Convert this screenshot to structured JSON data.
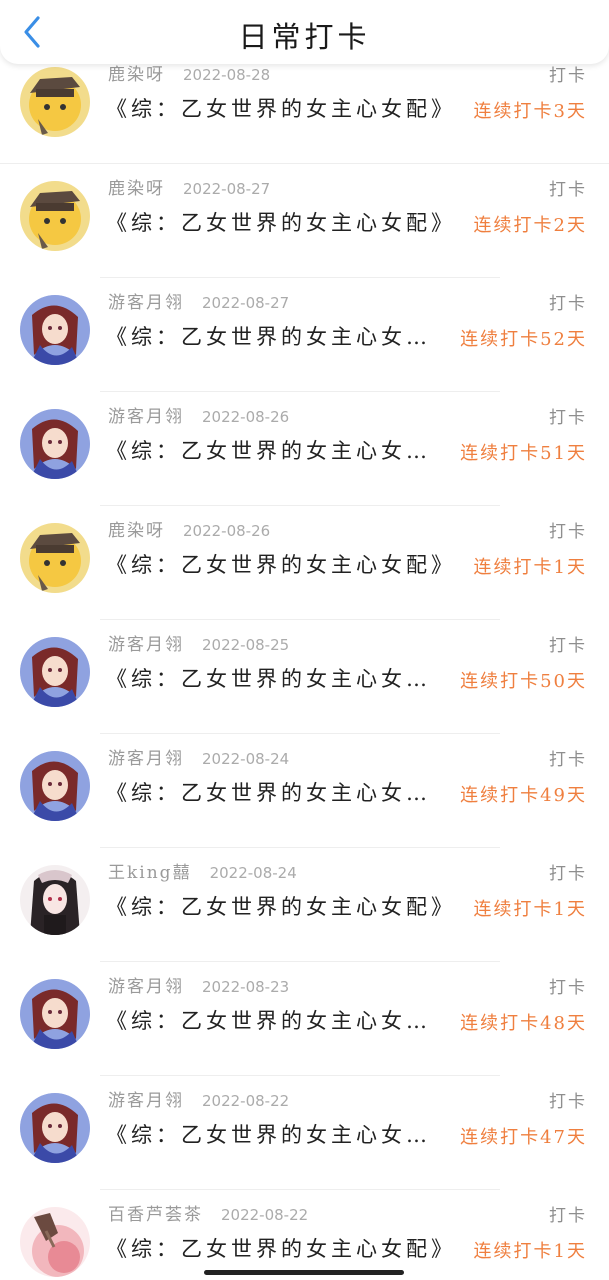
{
  "header": {
    "title": "日常打卡",
    "accent_color": "#3a8ee6"
  },
  "checkins": [
    {
      "user": "鹿染呀",
      "date": "2022-08-28",
      "tag": "打卡",
      "book": "《综：乙女世界的女主心女配》",
      "streak": "连续打卡3天",
      "avatar": "yellow-hat-character-icon"
    },
    {
      "user": "鹿染呀",
      "date": "2022-08-27",
      "tag": "打卡",
      "book": "《综：乙女世界的女主心女配》",
      "streak": "连续打卡2天",
      "avatar": "yellow-hat-character-icon"
    },
    {
      "user": "游客月翎",
      "date": "2022-08-27",
      "tag": "打卡",
      "book": "《综：乙女世界的女主心女…",
      "streak": "连续打卡52天",
      "avatar": "anime-girl-blue-icon"
    },
    {
      "user": "游客月翎",
      "date": "2022-08-26",
      "tag": "打卡",
      "book": "《综：乙女世界的女主心女…",
      "streak": "连续打卡51天",
      "avatar": "anime-girl-blue-icon"
    },
    {
      "user": "鹿染呀",
      "date": "2022-08-26",
      "tag": "打卡",
      "book": "《综：乙女世界的女主心女配》",
      "streak": "连续打卡1天",
      "avatar": "yellow-hat-character-icon"
    },
    {
      "user": "游客月翎",
      "date": "2022-08-25",
      "tag": "打卡",
      "book": "《综：乙女世界的女主心女…",
      "streak": "连续打卡50天",
      "avatar": "anime-girl-blue-icon"
    },
    {
      "user": "游客月翎",
      "date": "2022-08-24",
      "tag": "打卡",
      "book": "《综：乙女世界的女主心女…",
      "streak": "连续打卡49天",
      "avatar": "anime-girl-blue-icon"
    },
    {
      "user": "王king囍",
      "date": "2022-08-24",
      "tag": "打卡",
      "book": "《综：乙女世界的女主心女配》",
      "streak": "连续打卡1天",
      "avatar": "anime-girl-dark-icon"
    },
    {
      "user": "游客月翎",
      "date": "2022-08-23",
      "tag": "打卡",
      "book": "《综：乙女世界的女主心女…",
      "streak": "连续打卡48天",
      "avatar": "anime-girl-blue-icon"
    },
    {
      "user": "游客月翎",
      "date": "2022-08-22",
      "tag": "打卡",
      "book": "《综：乙女世界的女主心女…",
      "streak": "连续打卡47天",
      "avatar": "anime-girl-blue-icon"
    },
    {
      "user": "百香芦荟茶",
      "date": "2022-08-22",
      "tag": "打卡",
      "book": "《综：乙女世界的女主心女配》",
      "streak": "连续打卡1天",
      "avatar": "pink-watercolor-icon"
    }
  ]
}
